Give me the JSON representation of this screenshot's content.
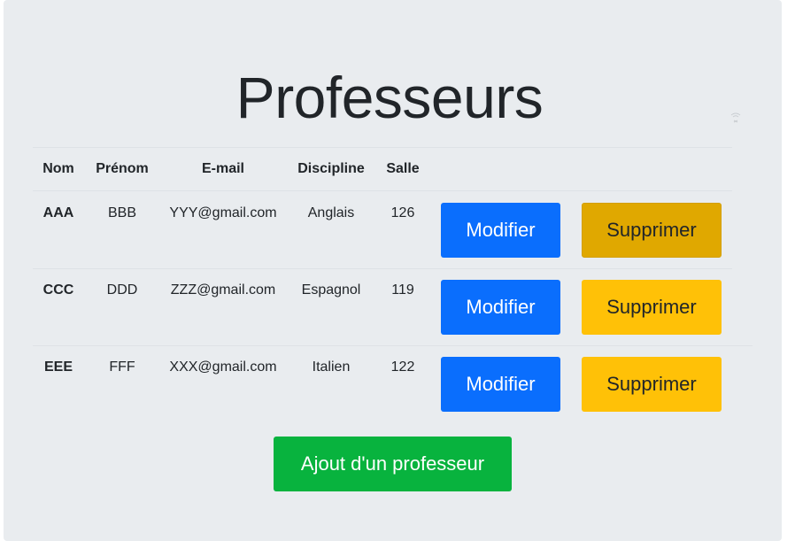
{
  "page": {
    "title": "Professeurs"
  },
  "table": {
    "headers": [
      "Nom",
      "Prénom",
      "E-mail",
      "Discipline",
      "Salle"
    ],
    "rows": [
      {
        "nom": "AAA",
        "prenom": "BBB",
        "email": "YYY@gmail.com",
        "discipline": "Anglais",
        "salle": "126",
        "modifier": "Modifier",
        "supprimer": "Supprimer"
      },
      {
        "nom": "CCC",
        "prenom": "DDD",
        "email": "ZZZ@gmail.com",
        "discipline": "Espagnol",
        "salle": "119",
        "modifier": "Modifier",
        "supprimer": "Supprimer"
      },
      {
        "nom": "EEE",
        "prenom": "FFF",
        "email": "XXX@gmail.com",
        "discipline": "Italien",
        "salle": "122",
        "modifier": "Modifier",
        "supprimer": "Supprimer"
      }
    ]
  },
  "actions": {
    "add_label": "Ajout d'un professeur"
  },
  "colors": {
    "background": "#e9ecef",
    "primary": "#0a6efd",
    "warning": "#ffc107",
    "warning_active": "#e0a800",
    "success": "#08b33e"
  },
  "icons": {
    "faint_top_right": "wifi-icon"
  }
}
